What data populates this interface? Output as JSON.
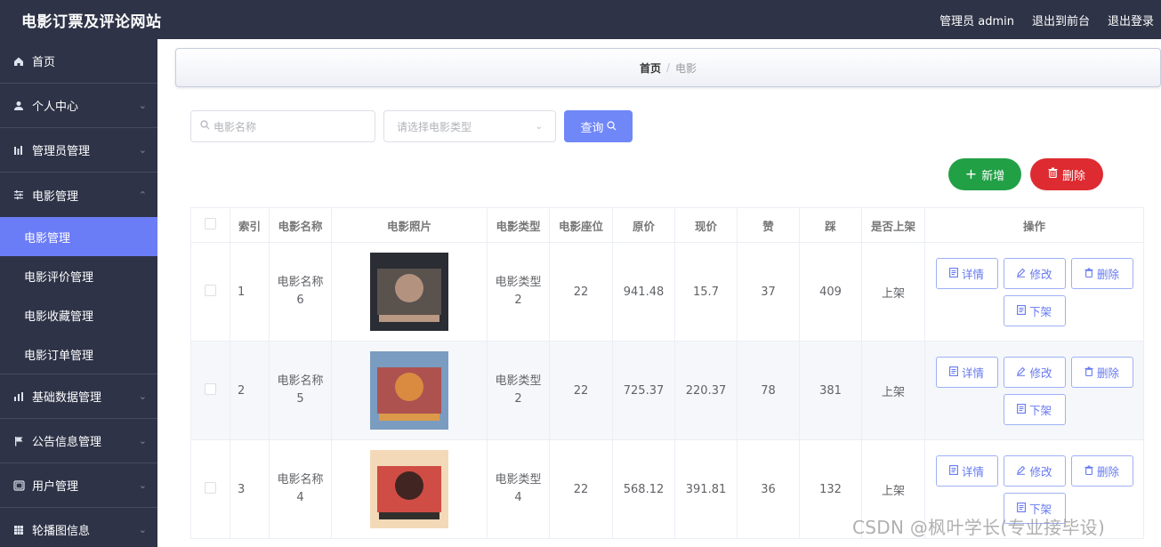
{
  "app": {
    "title": "电影订票及评论网站",
    "admin_label": "管理员 admin",
    "back_to_front": "退出到前台",
    "logout": "退出登录"
  },
  "sidebar": {
    "items": [
      {
        "label": "首页",
        "icon": "home-icon"
      },
      {
        "label": "个人中心",
        "icon": "user-icon"
      },
      {
        "label": "管理员管理",
        "icon": "bars-icon"
      },
      {
        "label": "电影管理",
        "icon": "sliders-icon"
      },
      {
        "label": "基础数据管理",
        "icon": "chart-icon"
      },
      {
        "label": "公告信息管理",
        "icon": "flag-icon"
      },
      {
        "label": "用户管理",
        "icon": "window-icon"
      },
      {
        "label": "轮播图信息",
        "icon": "grid-icon"
      }
    ],
    "sub_items": [
      "电影管理",
      "电影评价管理",
      "电影收藏管理",
      "电影订单管理"
    ]
  },
  "breadcrumb": {
    "home": "首页",
    "current": "电影"
  },
  "search": {
    "name_placeholder": "电影名称",
    "type_placeholder": "请选择电影类型",
    "query_label": "查询"
  },
  "actions": {
    "add": "新增",
    "delete": "删除"
  },
  "table": {
    "headers": [
      "索引",
      "电影名称",
      "电影照片",
      "电影类型",
      "电影座位",
      "原价",
      "现价",
      "赞",
      "踩",
      "是否上架",
      "操作"
    ],
    "rows": [
      {
        "index": "1",
        "name": "电影名称6",
        "type": "电影类型2",
        "seats": "22",
        "orig_price": "941.48",
        "price": "15.7",
        "likes": "37",
        "dislikes": "409",
        "status": "上架",
        "poster_colors": [
          "#2a2d33",
          "#6b5f57",
          "#c9a48d"
        ]
      },
      {
        "index": "2",
        "name": "电影名称5",
        "type": "电影类型2",
        "seats": "22",
        "orig_price": "725.37",
        "price": "220.37",
        "likes": "78",
        "dislikes": "381",
        "status": "上架",
        "poster_colors": [
          "#7a9cc0",
          "#c0392b",
          "#e59a3c"
        ]
      },
      {
        "index": "3",
        "name": "电影名称4",
        "type": "电影类型4",
        "seats": "22",
        "orig_price": "568.12",
        "price": "391.81",
        "likes": "36",
        "dislikes": "132",
        "status": "上架",
        "poster_colors": [
          "#f3d9b8",
          "#c31e1e",
          "#1c1c1c"
        ]
      }
    ],
    "ops": {
      "detail": "详情",
      "edit": "修改",
      "delete": "删除",
      "off_shelf": "下架"
    }
  },
  "watermark": "CSDN @枫叶学长(专业接毕设)",
  "colors": {
    "sidebar_bg": "#2e3347",
    "accent": "#6b7cf7",
    "add_green": "#22a046",
    "delete_red": "#dd2b31"
  }
}
